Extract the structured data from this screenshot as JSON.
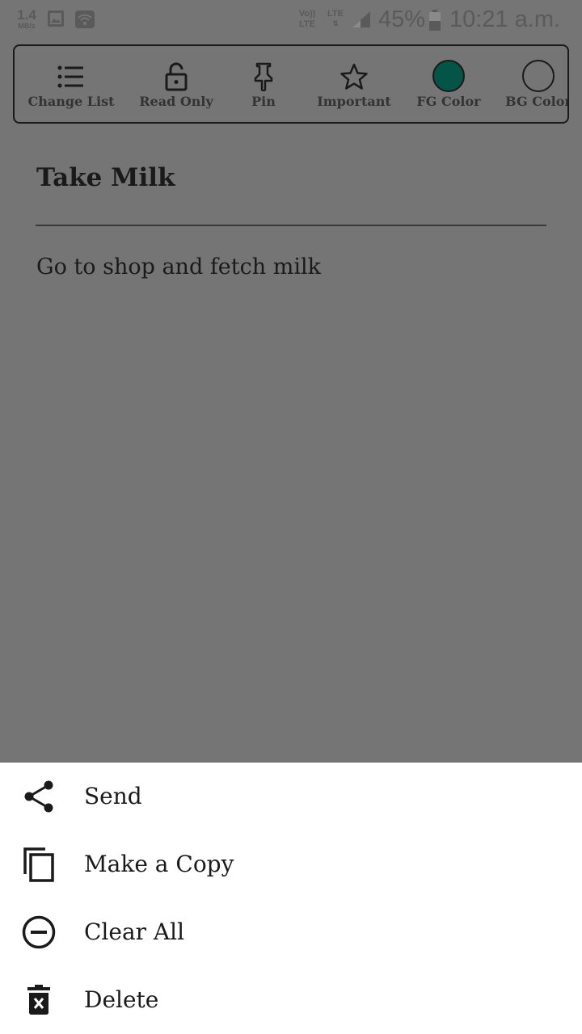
{
  "status_bar": {
    "speed_value": "1.4",
    "speed_unit": "MB/s",
    "volte_top": "Vo))",
    "volte_bottom": "LTE",
    "lte_label": "LTE",
    "battery": "45%",
    "time": "10:21 a.m."
  },
  "toolbar": {
    "items": [
      {
        "label": "Change List",
        "icon": "list-icon"
      },
      {
        "label": "Read Only",
        "icon": "lock-open-icon"
      },
      {
        "label": "Pin",
        "icon": "pin-icon"
      },
      {
        "label": "Important",
        "icon": "star-icon"
      },
      {
        "label": "FG Color",
        "icon": "color-swatch-icon",
        "color": "#045448"
      },
      {
        "label": "BG Color",
        "icon": "color-swatch-icon",
        "color": "#757575"
      }
    ]
  },
  "note": {
    "title": "Take Milk",
    "body": "Go to shop and fetch milk"
  },
  "bottom_sheet": {
    "items": [
      {
        "label": "Send",
        "icon": "share-icon"
      },
      {
        "label": "Make a Copy",
        "icon": "copy-icon"
      },
      {
        "label": "Clear All",
        "icon": "clear-all-icon"
      },
      {
        "label": "Delete",
        "icon": "delete-icon"
      }
    ]
  },
  "colors": {
    "scrim": "#757575",
    "sheet_background": "#ffffff",
    "fg_color": "#045448"
  }
}
